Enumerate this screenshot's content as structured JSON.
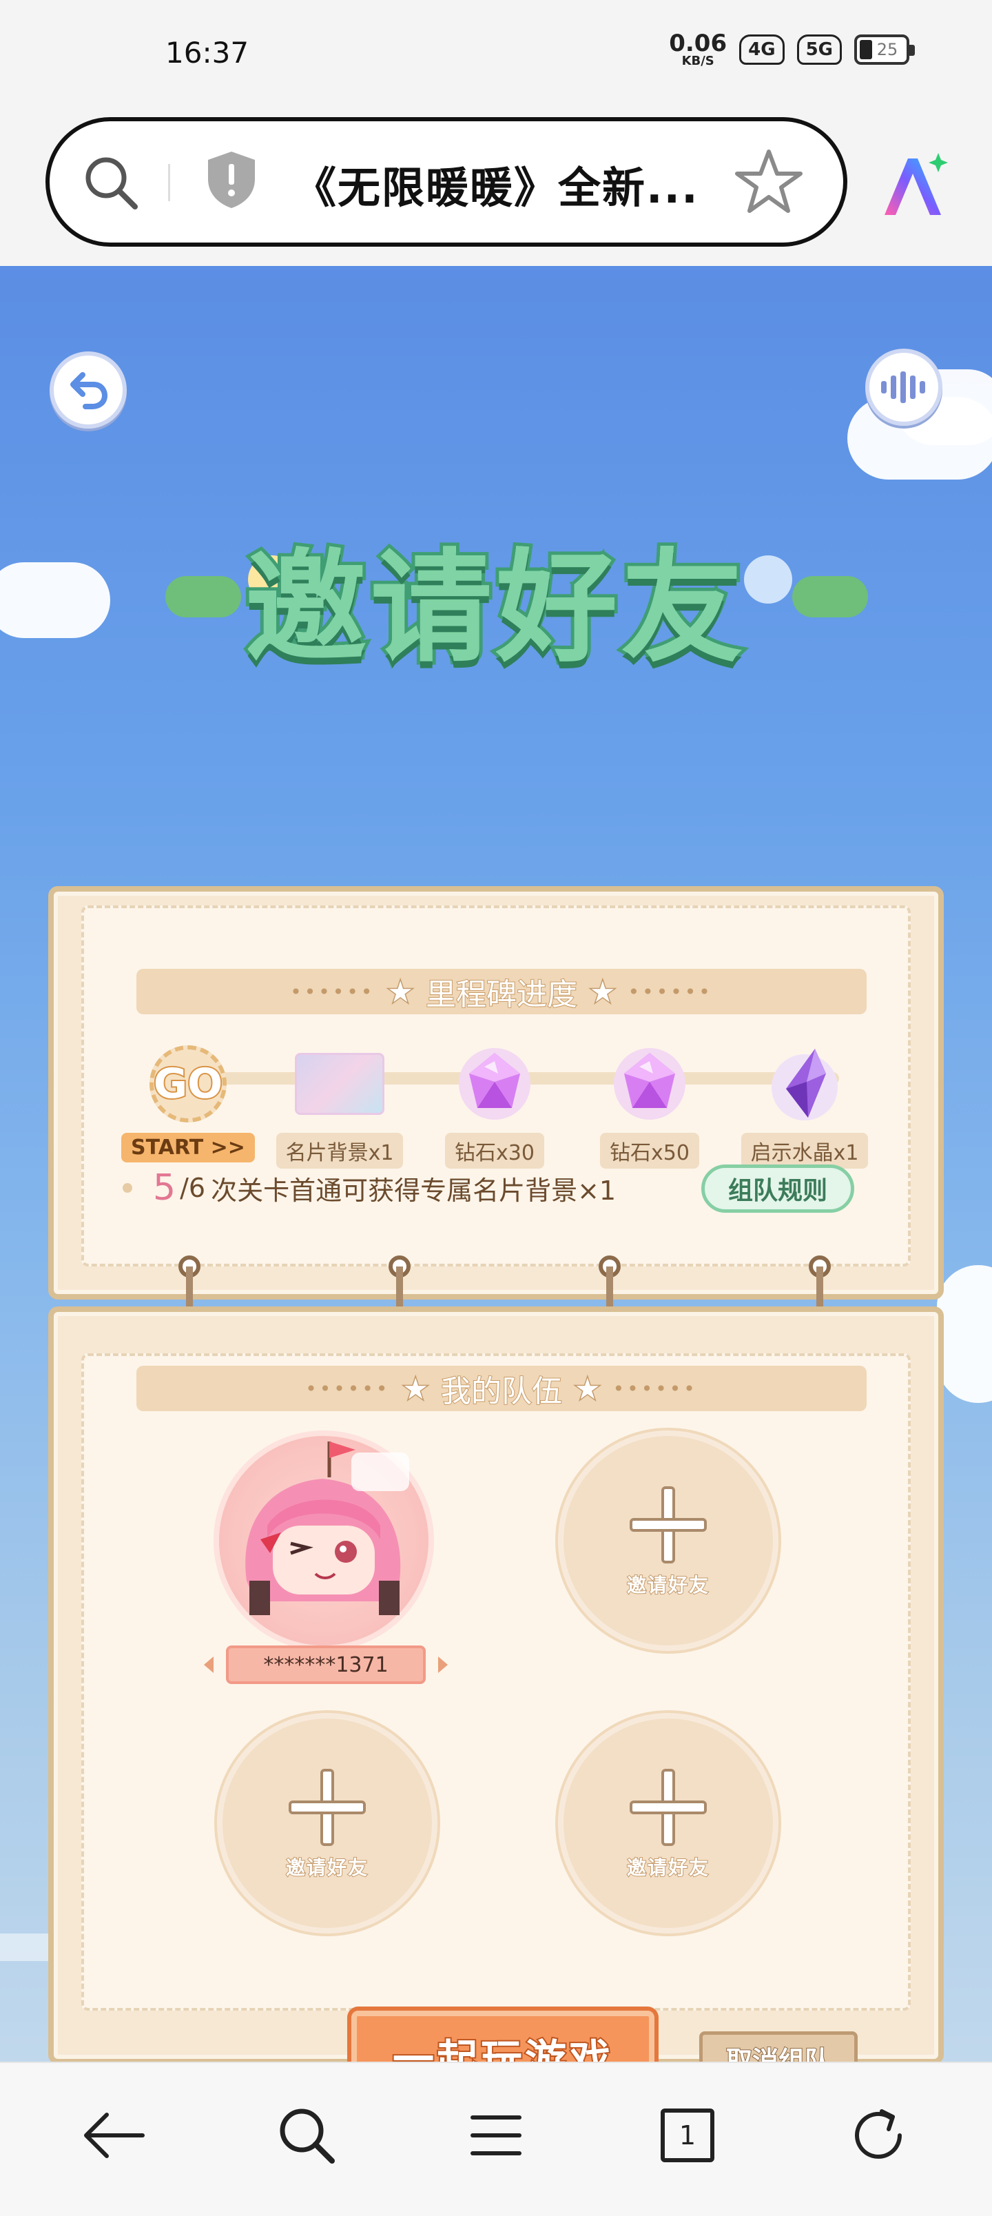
{
  "status_bar": {
    "time": "16:37",
    "net_speed_value": "0.06",
    "net_speed_unit": "KB/S",
    "signal_1": "4G",
    "signal_2": "5G",
    "battery": "25"
  },
  "browser": {
    "url_title": "《无限暖暖》全新...",
    "icons": [
      "search-icon",
      "shield-icon",
      "star-icon",
      "ai-assistant-icon"
    ]
  },
  "game": {
    "title": "邀请好友",
    "icons": [
      "back-icon",
      "sound-icon"
    ],
    "milestones": {
      "header": "里程碑进度",
      "items": [
        {
          "icon": "go-badge-icon",
          "badge_text": "GO",
          "label": "START >>"
        },
        {
          "icon": "namecard-background-icon",
          "label": "名片背景x1"
        },
        {
          "icon": "diamond-icon",
          "label": "钻石x30"
        },
        {
          "icon": "diamond-icon",
          "label": "钻石x50"
        },
        {
          "icon": "crystal-icon",
          "label": "启示水晶x1"
        }
      ],
      "progress_current": "5",
      "progress_total": "/6",
      "progress_text": "次关卡首通可获得专属名片背景×1",
      "rules_button": "组队规则"
    },
    "team": {
      "header": "我的队伍",
      "member_name": "*******1371",
      "invite_slot_label": "邀请好友",
      "invite_slots": 3
    },
    "play_button": "一起玩游戏",
    "cancel_button": "取消组队"
  },
  "nav": {
    "tab_count": "1",
    "icons": [
      "back-arrow-icon",
      "search-icon",
      "menu-icon",
      "tabs-icon",
      "refresh-icon"
    ]
  },
  "colors": {
    "title_green": "#7fd3a4",
    "sky_blue": "#5b8ee4",
    "accent_orange": "#f5955c",
    "pink": "#e27793"
  }
}
